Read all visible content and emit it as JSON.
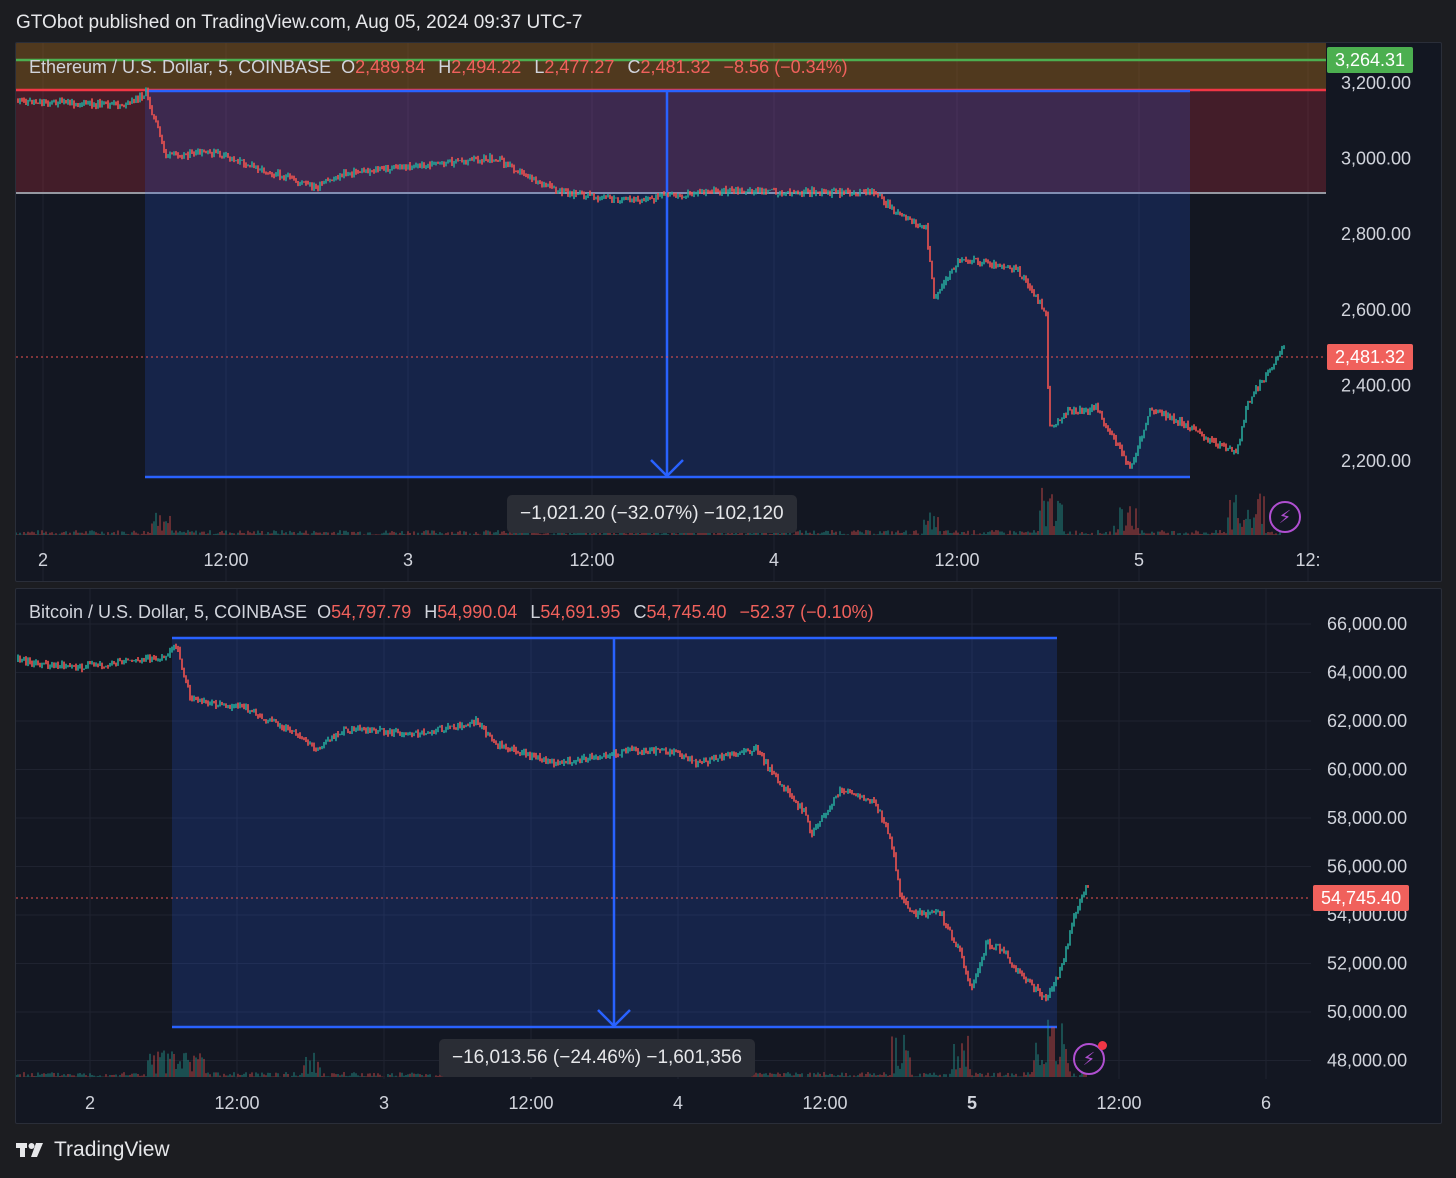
{
  "header": {
    "published": "GTObot published on TradingView.com, Aug 05, 2024 09:37 UTC-7"
  },
  "footer": {
    "brand": "TradingView"
  },
  "colors": {
    "background": "#131722",
    "up": "#26a69a",
    "down": "#ef5350",
    "measure_blue": "#2962ff",
    "green_line": "#4caf50",
    "red_line": "#f23645"
  },
  "eth": {
    "symbol": "Ethereum / U.S. Dollar, 5, COINBASE",
    "o_label": "O",
    "o_value": "2,489.84",
    "h_label": "H",
    "h_value": "2,494.22",
    "l_label": "L",
    "l_value": "2,477.27",
    "c_label": "C",
    "c_value": "2,481.32",
    "change": "−8.56 (−0.34%)",
    "top_tag": "3,264.31",
    "price_tag": "2,481.32",
    "measure": "−1,021.20 (−32.07%) −102,120",
    "y_ticks": [
      "3,200.00",
      "3,000.00",
      "2,800.00",
      "2,600.00",
      "2,400.00",
      "2,200.00"
    ],
    "x_ticks": [
      "2",
      "12:00",
      "3",
      "12:00",
      "4",
      "12:00",
      "5",
      "12:"
    ]
  },
  "btc": {
    "symbol": "Bitcoin / U.S. Dollar, 5, COINBASE",
    "o_label": "O",
    "o_value": "54,797.79",
    "h_label": "H",
    "h_value": "54,990.04",
    "l_label": "L",
    "l_value": "54,691.95",
    "c_label": "C",
    "c_value": "54,745.40",
    "change": "−52.37 (−0.10%)",
    "price_tag": "54,745.40",
    "measure": "−16,013.56 (−24.46%) −1,601,356",
    "y_ticks": [
      "66,000.00",
      "64,000.00",
      "62,000.00",
      "60,000.00",
      "58,000.00",
      "56,000.00",
      "54,000.00",
      "52,000.00",
      "50,000.00",
      "48,000.00"
    ],
    "x_ticks": [
      "2",
      "12:00",
      "3",
      "12:00",
      "4",
      "12:00",
      "5",
      "12:00",
      "6"
    ]
  }
}
